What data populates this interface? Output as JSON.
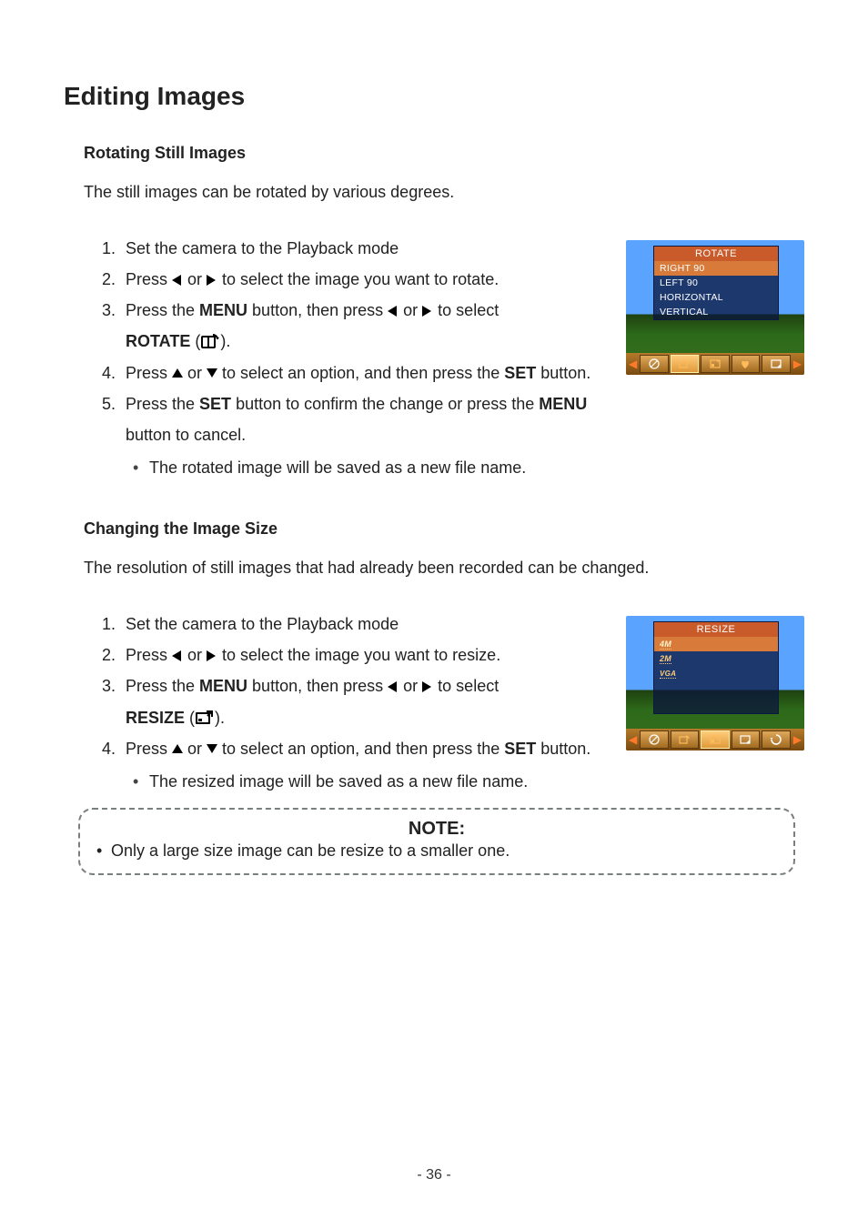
{
  "page": {
    "title": "Editing Images",
    "number": "- 36 -"
  },
  "section1": {
    "heading": "Rotating Still Images",
    "intro": "The still images can be rotated by various degrees.",
    "step1": "Set the camera to the Playback mode",
    "step2a": "Press ",
    "step2b": " or ",
    "step2c": " to select the image you want to rotate.",
    "step3a": "Press the ",
    "menu": "MENU",
    "step3b": " button, then press ",
    "step3c": " to select ",
    "rotate_label": "ROTATE",
    "step3d": " (",
    "step3e": ").",
    "step4a": "Press ",
    "step4b": " to select an option, and then press the ",
    "set": "SET",
    "step4c": " button.",
    "step5a": "Press the ",
    "step5b": " button to confirm the change or press the ",
    "step5c": " button to cancel.",
    "bullet": "The rotated image will be saved as a new file name.",
    "cam": {
      "title": "ROTATE",
      "opt1": "RIGHT 90",
      "opt2": "LEFT 90",
      "opt3": "HORIZONTAL",
      "opt4": "VERTICAL"
    }
  },
  "section2": {
    "heading": "Changing the Image Size",
    "intro": "The resolution of still images that had already been recorded can be changed.",
    "step1": "Set the camera to the Playback mode",
    "step2a": "Press ",
    "step2b": " or ",
    "step2c": " to select the image you want to resize.",
    "step3a": "Press the ",
    "menu": "MENU",
    "step3b": " button, then press ",
    "step3c": " to select ",
    "resize_label": "RESIZE",
    "step3d": " (",
    "step3e": ").",
    "step4a": "Press ",
    "step4b": " to select an option, and then press the ",
    "set": "SET",
    "step4c": " button.",
    "bullet": "The resized image will be saved as a new file name.",
    "cam": {
      "title": "RESIZE",
      "opt1": "4M",
      "opt2": "2M",
      "opt3": "VGA"
    }
  },
  "note": {
    "title": "NOTE:",
    "line1": "Only a large size image can be resize to a smaller one."
  }
}
